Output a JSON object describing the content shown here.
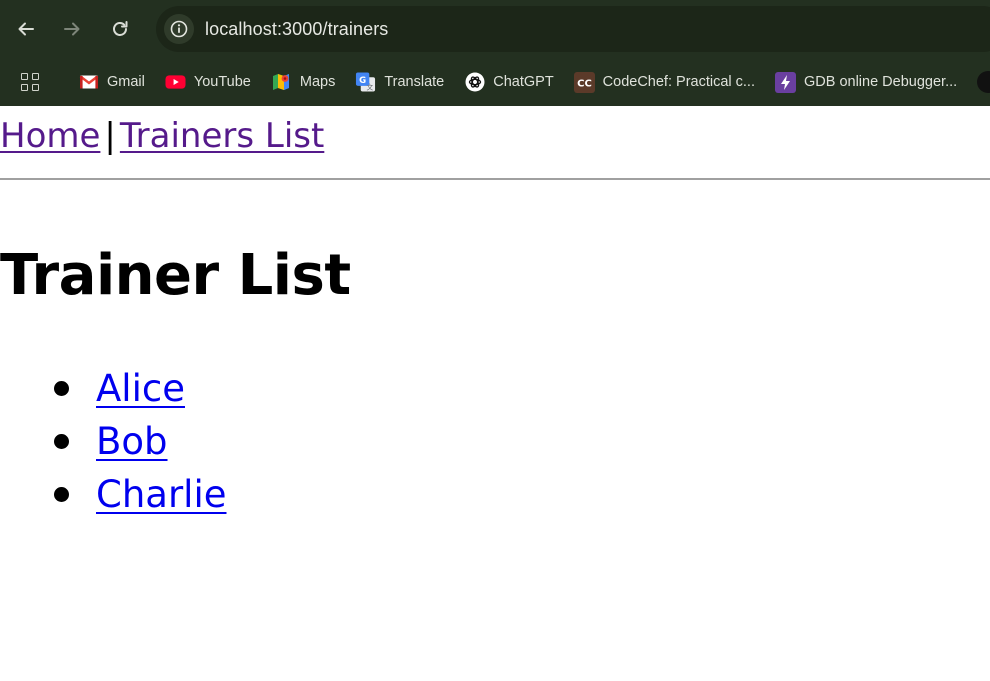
{
  "browser": {
    "url": "localhost:3000/trainers",
    "bookmarks": [
      {
        "label": "Gmail",
        "icon": "gmail-icon"
      },
      {
        "label": "YouTube",
        "icon": "youtube-icon"
      },
      {
        "label": "Maps",
        "icon": "maps-icon"
      },
      {
        "label": "Translate",
        "icon": "translate-icon"
      },
      {
        "label": "ChatGPT",
        "icon": "chatgpt-icon"
      },
      {
        "label": "CodeChef: Practical c...",
        "icon": "codechef-icon"
      },
      {
        "label": "GDB online Debugger...",
        "icon": "gdb-icon"
      }
    ],
    "colors": {
      "chrome_bg": "#233020",
      "omnibox_bg": "#1c2618"
    }
  },
  "nav": {
    "home_label": "Home",
    "separator": "|",
    "trainers_label": "Trainers List"
  },
  "main": {
    "heading": "Trainer List",
    "trainers": [
      "Alice",
      "Bob",
      "Charlie"
    ]
  }
}
